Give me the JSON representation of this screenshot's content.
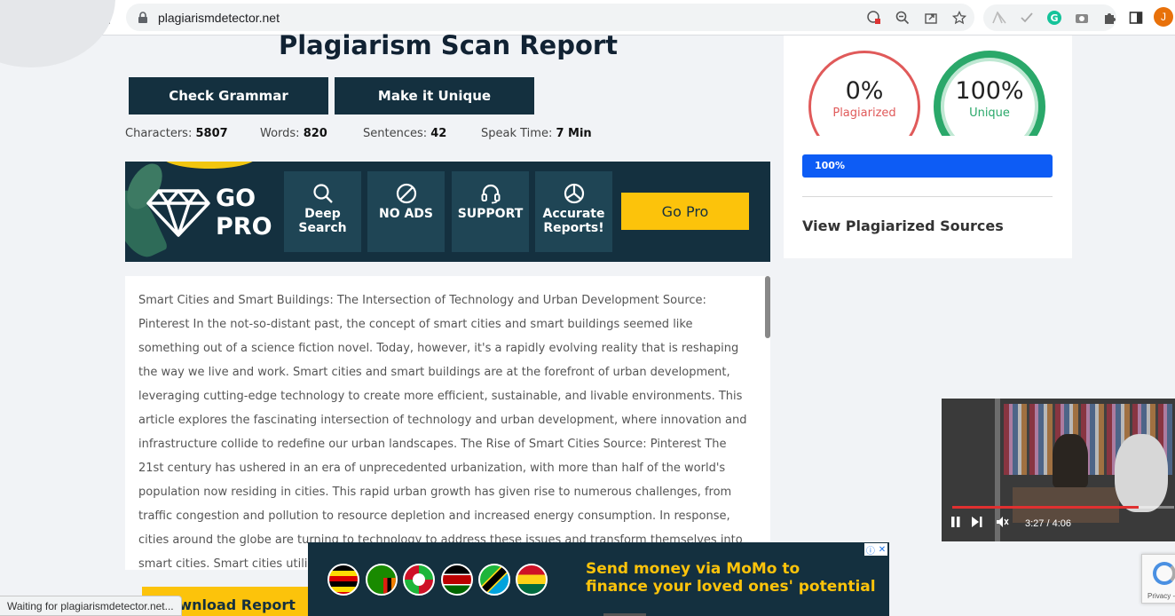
{
  "browser": {
    "url": "plagiarismdetector.net",
    "status_text": "Waiting for plagiarismdetector.net...",
    "profile_initial": "J"
  },
  "report": {
    "title": "Plagiarism Scan Report",
    "check_grammar_label": "Check Grammar",
    "make_unique_label": "Make it Unique",
    "stats": {
      "characters_label": "Characters:",
      "characters_value": "5807",
      "words_label": "Words:",
      "words_value": "820",
      "sentences_label": "Sentences:",
      "sentences_value": "42",
      "speak_time_label": "Speak Time:",
      "speak_time_value": "7 Min"
    },
    "text": "Smart Cities and Smart Buildings: The Intersection of Technology and Urban Development Source: Pinterest In the not-so-distant past, the concept of smart cities and smart buildings seemed like something out of a science fiction novel. Today, however, it's a rapidly evolving reality that is reshaping the way we live and work. Smart cities and smart buildings are at the forefront of urban development, leveraging cutting-edge technology to create more efficient, sustainable, and livable environments. This article explores the fascinating intersection of technology and urban development, where innovation and infrastructure collide to redefine our urban landscapes. The Rise of Smart Cities Source: Pinterest The 21st century has ushered in an era of unprecedented urbanization, with more than half of the world's population now residing in cities. This rapid urban growth has given rise to numerous challenges, from traffic congestion and pollution to resource depletion and increased energy consumption. In response, cities around the globe are turning to technology to address these issues and transform themselves into smart cities. Smart cities utiliz",
    "download_label": "Download Report"
  },
  "gopro": {
    "line1": "GO",
    "line2": "PRO",
    "features": [
      {
        "line1": "Deep",
        "line2": "Search",
        "icon": "search-icon"
      },
      {
        "line1": "NO ADS",
        "line2": "",
        "icon": "no-ads-icon"
      },
      {
        "line1": "SUPPORT",
        "line2": "",
        "icon": "headset-icon"
      },
      {
        "line1": "Accurate",
        "line2": "Reports!",
        "icon": "pie-chart-icon"
      }
    ],
    "button_label": "Go Pro",
    "accent": "#fcc30b",
    "bg": "#14303f"
  },
  "results": {
    "plagiarized_pct": "0%",
    "plagiarized_label": "Plagiarized",
    "unique_pct": "100%",
    "unique_label": "Unique",
    "progress_text": "100%",
    "progress_fraction": 1.0,
    "sources_label": "View Plagiarized Sources",
    "plagiarized_color": "#e05a5a",
    "unique_color": "#2aa86a"
  },
  "video": {
    "time": "3:27 / 4:06",
    "progress_fraction": 0.84
  },
  "ad": {
    "line1": "Send money via MoMo to",
    "line2": "finance your loved ones' potential"
  },
  "recaptcha": {
    "text": "Privacy - T"
  }
}
